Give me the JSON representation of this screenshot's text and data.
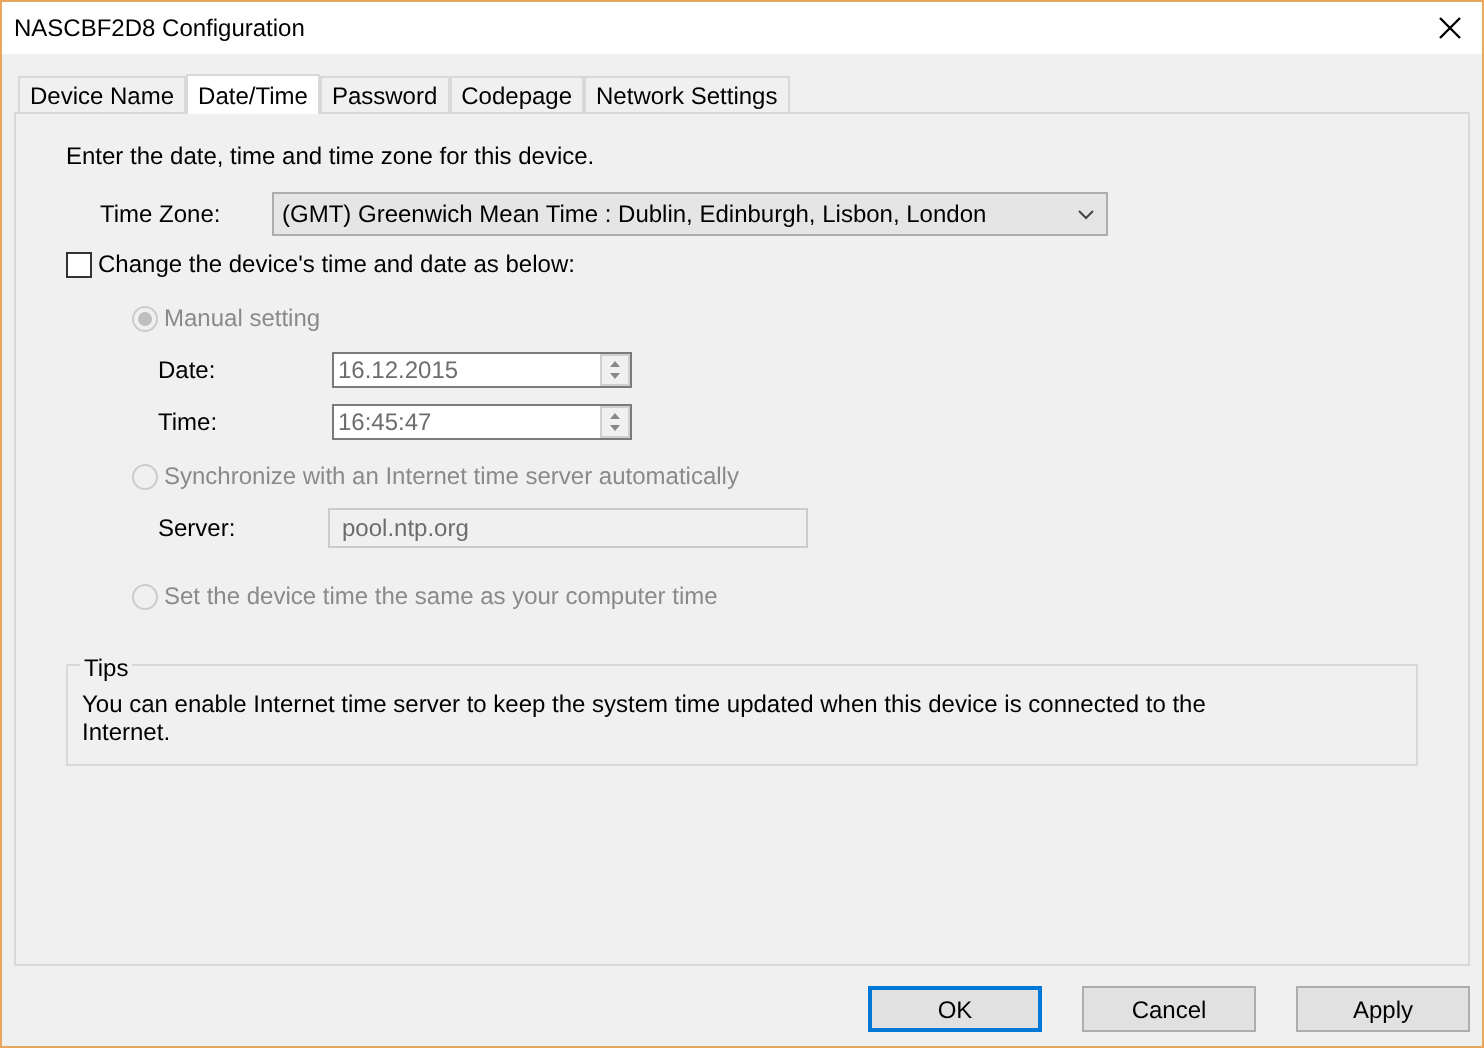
{
  "window": {
    "title": "NASCBF2D8 Configuration"
  },
  "tabs": [
    {
      "label": "Device Name",
      "selected": false
    },
    {
      "label": "Date/Time",
      "selected": true
    },
    {
      "label": "Password",
      "selected": false
    },
    {
      "label": "Codepage",
      "selected": false
    },
    {
      "label": "Network Settings",
      "selected": false
    }
  ],
  "intro": "Enter the date, time and time zone for this device.",
  "time_zone": {
    "label": "Time Zone:",
    "value": "(GMT) Greenwich Mean Time : Dublin, Edinburgh, Lisbon, London"
  },
  "change_time": {
    "label": "Change the device's time and date as below:",
    "checked": false
  },
  "options": [
    {
      "label": "Manual setting",
      "selected": true,
      "disabled": true,
      "fields": [
        {
          "kind": "spinner",
          "label": "Date:",
          "value": "16.12.2015"
        },
        {
          "kind": "spinner",
          "label": "Time:",
          "value": "16:45:47"
        }
      ]
    },
    {
      "label": "Synchronize with an Internet time server automatically",
      "selected": false,
      "disabled": true,
      "fields": [
        {
          "kind": "text",
          "label": "Server:",
          "value": "pool.ntp.org"
        }
      ]
    },
    {
      "label": "Set the device time the same as your computer time",
      "selected": false,
      "disabled": true
    }
  ],
  "tips": {
    "title": "Tips",
    "text": "You can enable Internet time server to keep the system time updated when this device is connected to the Internet."
  },
  "buttons": [
    {
      "label": "OK",
      "default": true
    },
    {
      "label": "Cancel",
      "default": false
    },
    {
      "label": "Apply",
      "default": false
    }
  ]
}
